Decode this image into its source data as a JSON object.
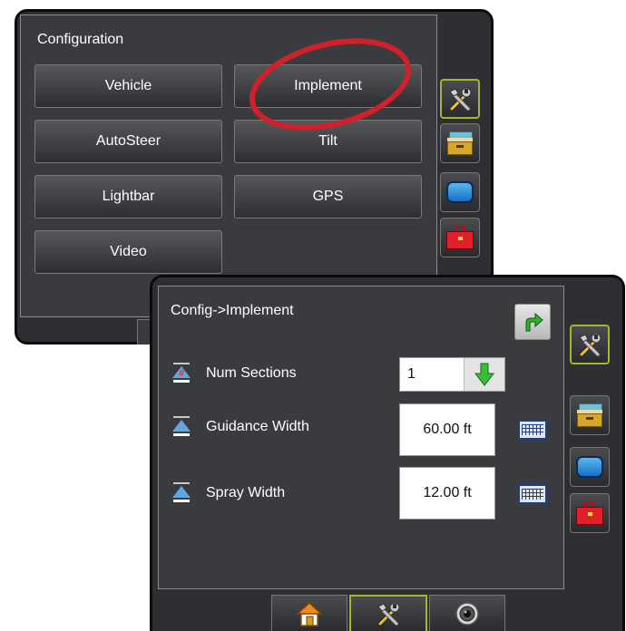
{
  "config_screen": {
    "title": "Configuration",
    "buttons": {
      "vehicle": "Vehicle",
      "implement": "Implement",
      "autosteer": "AutoSteer",
      "tilt": "Tilt",
      "lightbar": "Lightbar",
      "gps": "GPS",
      "video": "Video"
    }
  },
  "implement_screen": {
    "title": "Config->Implement",
    "num_sections": {
      "label": "Num Sections",
      "value": "1"
    },
    "guidance_width": {
      "label": "Guidance Width",
      "value": "60.00 ft"
    },
    "spray_width": {
      "label": "Spray Width",
      "value": "12.00 ft"
    }
  },
  "side_tabs": [
    "tools-icon",
    "folder-icon",
    "screen-icon",
    "toolbox-icon"
  ],
  "bottom_tabs": [
    "home-icon",
    "tools-icon",
    "camera-icon"
  ],
  "colors": {
    "active_border": "#a4b827",
    "highlight_ring": "#d0202a",
    "panel_bg": "#3a3b3e"
  }
}
